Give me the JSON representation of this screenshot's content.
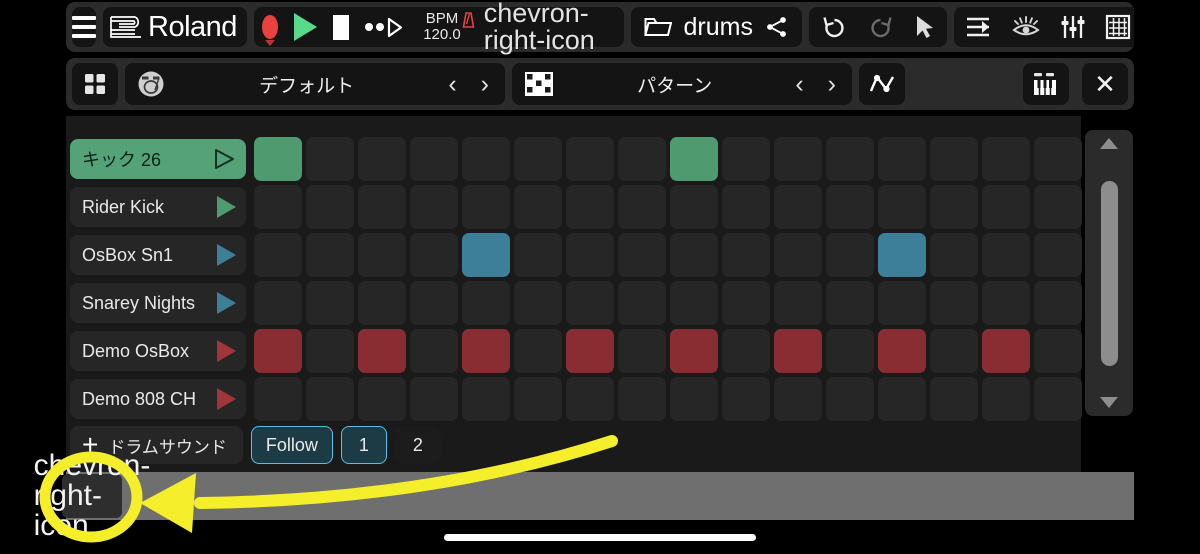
{
  "app": {
    "brand": "Roland",
    "file_name": "drums"
  },
  "toolbar": {
    "menu_icon": "hamburger-menu-icon",
    "record_icon": "record-icon",
    "play_icon": "play-icon",
    "stop_icon": "stop-icon",
    "loop_play_icon": "loop-play-icon",
    "bpm_label": "BPM",
    "bpm_value": "120.0",
    "metronome_icon": "metronome-icon",
    "bpm_expand_icon": "chevron-right-icon",
    "folder_icon": "folder-icon",
    "share_icon": "share-icon",
    "undo_icon": "undo-icon",
    "redo_icon": "redo-icon",
    "pointer_icon": "pointer-arrow-icon",
    "arrange_icon": "arrange-list-icon",
    "eye_icon": "eye-visibility-icon",
    "mixer_icon": "mixer-faders-icon",
    "grid_icon": "grid-icon"
  },
  "subtoolbar": {
    "grid_view_icon": "four-squares-icon",
    "kit_icon": "drum-kit-icon",
    "kit_name": "デフォルト",
    "kit_prev": "‹",
    "kit_next": "›",
    "pattern_icon": "pattern-matrix-icon",
    "pattern_name": "パターン",
    "pattern_prev": "‹",
    "pattern_next": "›",
    "automation_icon": "automation-curve-icon",
    "keyboard_icon": "keyboard-icon",
    "close_icon": "✕"
  },
  "colors": {
    "green": "#4f9a6e",
    "blue": "#3d7f99",
    "red": "#892d32",
    "cell_off": "#262626",
    "accent_cyan": "#4fc3e8",
    "annotation_yellow": "#f5ee2a"
  },
  "sequencer": {
    "step_count": 16,
    "tracks": [
      {
        "name": "キック 26",
        "color": "green",
        "selected": true,
        "steps": [
          1,
          0,
          0,
          0,
          0,
          0,
          0,
          0,
          1,
          0,
          0,
          0,
          0,
          0,
          0,
          0
        ]
      },
      {
        "name": "Rider Kick",
        "color": "green",
        "selected": false,
        "steps": [
          0,
          0,
          0,
          0,
          0,
          0,
          0,
          0,
          0,
          0,
          0,
          0,
          0,
          0,
          0,
          0
        ]
      },
      {
        "name": "OsBox Sn1",
        "color": "blue",
        "selected": false,
        "steps": [
          0,
          0,
          0,
          0,
          1,
          0,
          0,
          0,
          0,
          0,
          0,
          0,
          1,
          0,
          0,
          0
        ]
      },
      {
        "name": "Snarey Nights",
        "color": "blue",
        "selected": false,
        "steps": [
          0,
          0,
          0,
          0,
          0,
          0,
          0,
          0,
          0,
          0,
          0,
          0,
          0,
          0,
          0,
          0
        ]
      },
      {
        "name": "Demo OsBox",
        "color": "red",
        "selected": false,
        "steps": [
          1,
          0,
          1,
          0,
          1,
          0,
          1,
          0,
          1,
          0,
          1,
          0,
          1,
          0,
          1,
          0
        ]
      },
      {
        "name": "Demo 808 CH",
        "color": "red",
        "selected": false,
        "steps": [
          0,
          0,
          0,
          0,
          0,
          0,
          0,
          0,
          0,
          0,
          0,
          0,
          0,
          0,
          0,
          0
        ]
      }
    ],
    "scrollbar": {
      "up_icon": "scroll-up-arrow-icon",
      "down_icon": "scroll-down-arrow-icon"
    }
  },
  "bottom": {
    "add_icon": "plus-icon",
    "add_label": "ドラムサウンド",
    "follow_label": "Follow",
    "follow_active": true,
    "page_1": "1",
    "page_2": "2",
    "page_selected": "1",
    "expand_icon": "chevron-right-icon"
  },
  "annotation": {
    "type": "highlight-circle-and-arrow",
    "target": "expand-panel-chevron-button",
    "color": "#f5ee2a"
  }
}
